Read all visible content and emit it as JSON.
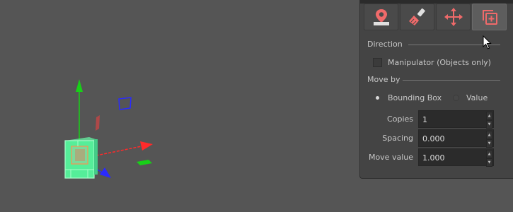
{
  "viewport": {
    "gizmo_colors": {
      "x_axis": "#ff2a2a",
      "y_axis": "#18d018",
      "z_axis": "#2a2aff",
      "selection": "#55ee99"
    }
  },
  "toolbar": {
    "buttons": [
      {
        "icon": "place-on-surface-icon",
        "active": false
      },
      {
        "icon": "paint-brush-icon",
        "active": false
      },
      {
        "icon": "move-arrows-icon",
        "active": false
      },
      {
        "icon": "duplicate-icon",
        "active": true
      }
    ],
    "icon_color": "#f06a6a"
  },
  "direction": {
    "header": "Direction",
    "manipulator_label": "Manipulator (Objects only)",
    "manipulator_checked": false
  },
  "move_by": {
    "header": "Move by",
    "options": [
      "Bounding Box",
      "Value"
    ],
    "selected": "Bounding Box"
  },
  "fields": {
    "copies": {
      "label": "Copies",
      "value": "1"
    },
    "spacing": {
      "label": "Spacing",
      "value": "0.000"
    },
    "move_value": {
      "label": "Move value",
      "value": "1.000"
    }
  }
}
